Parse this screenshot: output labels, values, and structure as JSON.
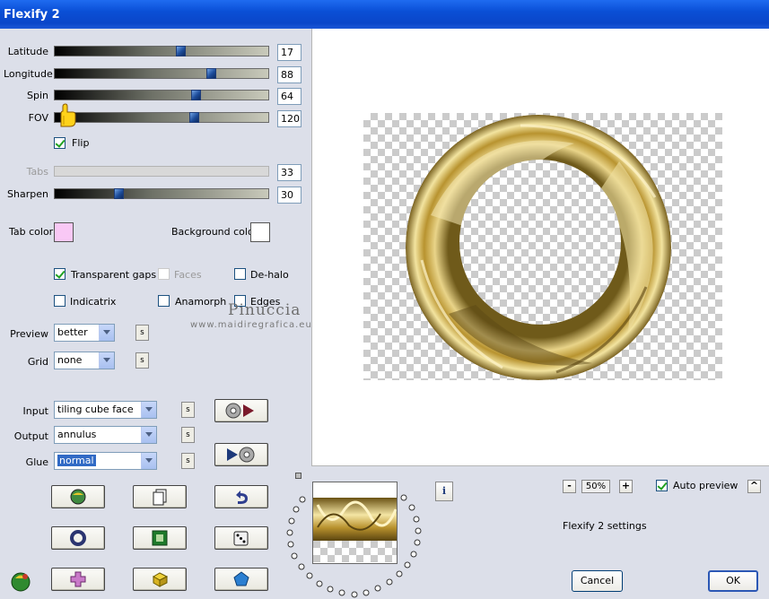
{
  "window": {
    "title": "Flexify 2"
  },
  "sliders": [
    {
      "label": "Latitude",
      "value": "17",
      "level": 0.59
    },
    {
      "label": "Longitude",
      "value": "88",
      "level": 0.73
    },
    {
      "label": "Spin",
      "value": "64",
      "level": 0.66
    },
    {
      "label": "FOV",
      "value": "120",
      "level": 0.65
    }
  ],
  "flip": {
    "label": "Flip",
    "checked": true
  },
  "tabs": {
    "label": "Tabs",
    "value": "33"
  },
  "sharpen": {
    "label": "Sharpen",
    "value": "30",
    "level": 0.3
  },
  "colors": {
    "tab_color_label": "Tab color",
    "tab_color": "#f9c8f5",
    "background_label": "Background color",
    "background_color": "#ffffff"
  },
  "options": {
    "transparent_gaps": "Transparent gaps",
    "faces": "Faces",
    "dehalo": "De-halo",
    "indicatrix": "Indicatrix",
    "anamorph": "Anamorph",
    "edges": "Edges"
  },
  "preview": {
    "label": "Preview",
    "value": "better"
  },
  "grid": {
    "label": "Grid",
    "value": "none"
  },
  "input": {
    "label": "Input",
    "value": "tiling cube face"
  },
  "output": {
    "label": "Output",
    "value": "annulus"
  },
  "glue": {
    "label": "Glue",
    "value": "normal"
  },
  "small_button": "s",
  "watermark": {
    "name": "Pinuccia",
    "url": "www.maidiregrafica.eu"
  },
  "zoom": {
    "minus": "-",
    "value": "50%",
    "plus": "+"
  },
  "auto_preview": {
    "label": "Auto preview",
    "checked": true,
    "up": "^"
  },
  "settings_label": "Flexify 2 settings",
  "buttons": {
    "cancel": "Cancel",
    "ok": "OK"
  },
  "info": "i",
  "accent": {
    "ring_gold": "#c9a740",
    "title_blue": "#0a4fd6"
  }
}
